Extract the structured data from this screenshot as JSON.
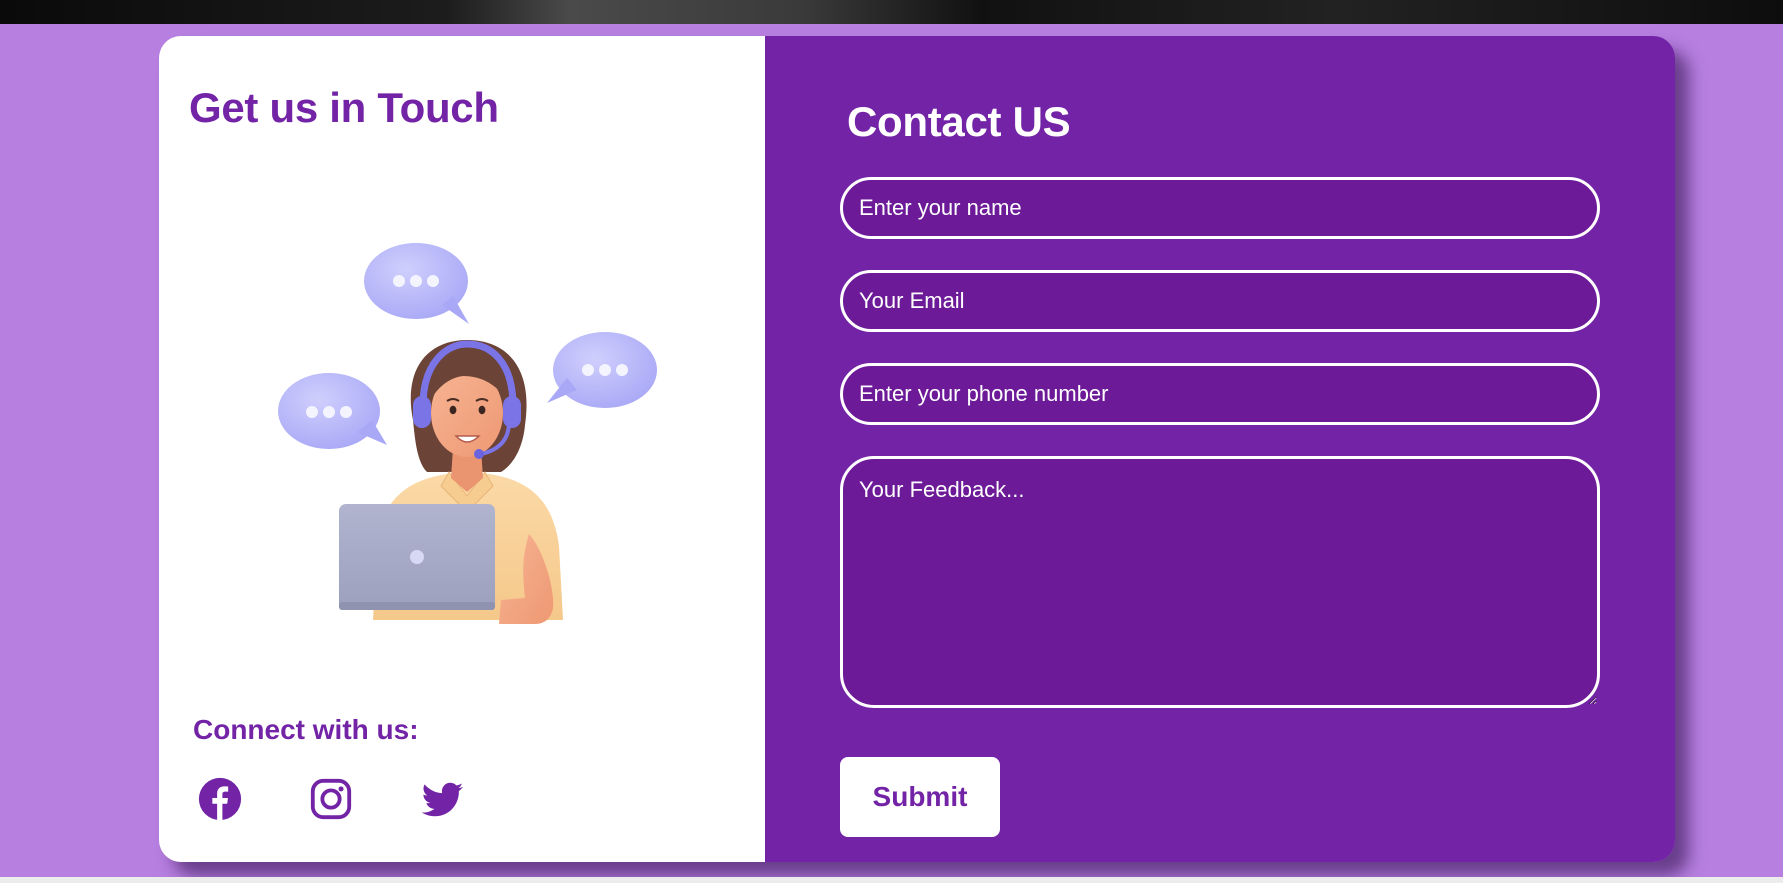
{
  "topbar": {
    "fragment": ""
  },
  "left": {
    "title": "Get us in Touch",
    "illustration": "customer-support-agent-with-headset-and-laptop",
    "connect_label": "Connect with us:",
    "socials": [
      {
        "icon": "facebook-icon"
      },
      {
        "icon": "instagram-icon"
      },
      {
        "icon": "twitter-icon"
      }
    ]
  },
  "form": {
    "title": "Contact US",
    "name_placeholder": "Enter your name",
    "email_placeholder": "Your Email",
    "phone_placeholder": "Enter your phone number",
    "feedback_placeholder": "Your Feedback...",
    "submit_label": "Submit"
  },
  "colors": {
    "background": "#b77fe0",
    "panel_white": "#ffffff",
    "panel_purple": "#7324a6",
    "field_fill": "#6c1a98",
    "accent_text": "#7324a6",
    "bubble": "#b4b3fb",
    "skin": "#f5a983",
    "shirt": "#f9d19b",
    "laptop": "#a7abc8"
  }
}
